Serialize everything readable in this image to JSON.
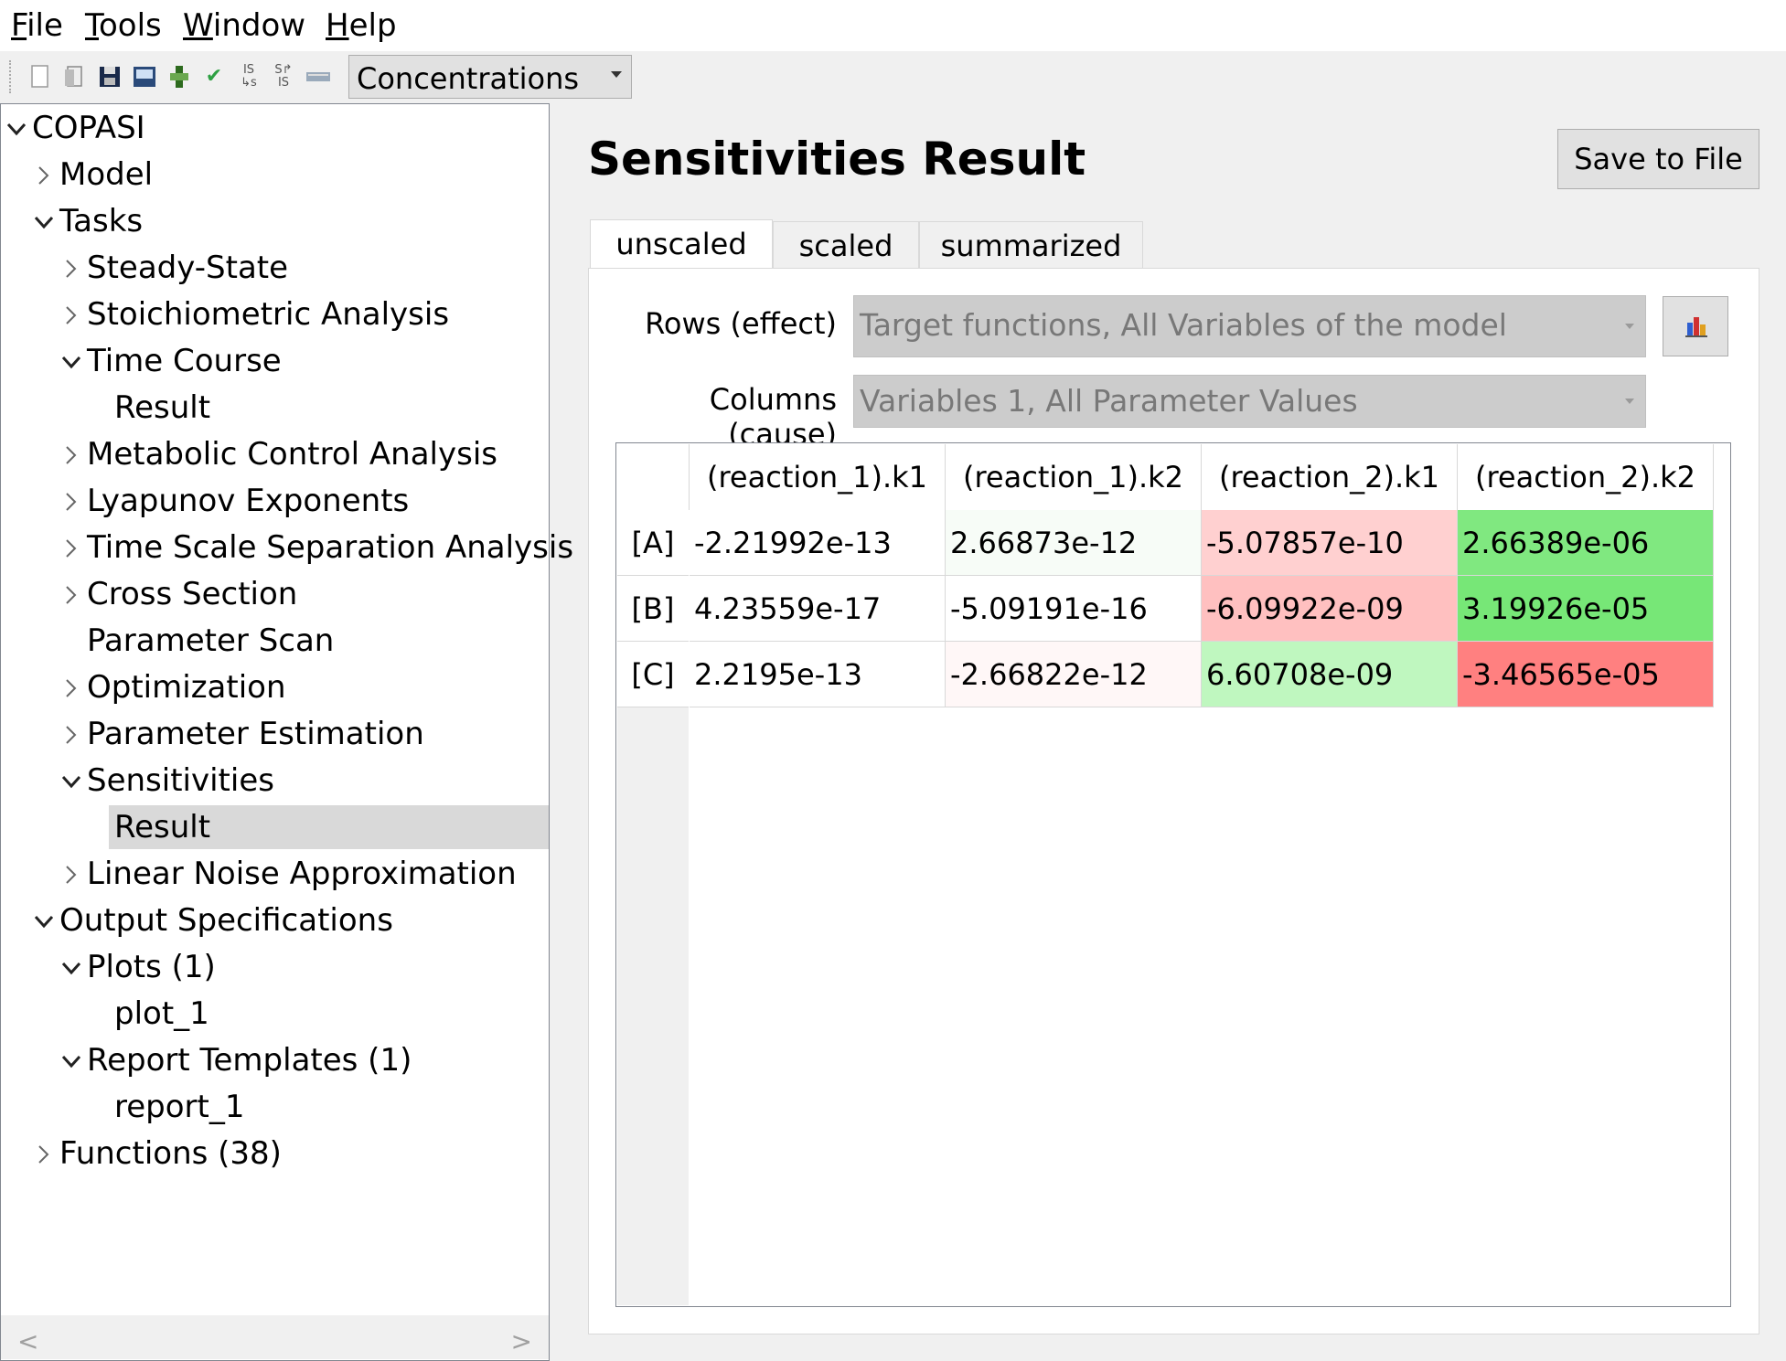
{
  "menubar": {
    "items": [
      {
        "label": "File",
        "mnemonic": "F",
        "rest": "ile"
      },
      {
        "label": "Tools",
        "mnemonic": "T",
        "rest": "ools"
      },
      {
        "label": "Window",
        "mnemonic": "W",
        "rest": "indow"
      },
      {
        "label": "Help",
        "mnemonic": "H",
        "rest": "elp"
      }
    ]
  },
  "toolbar": {
    "icons": [
      "new-icon",
      "open-icon",
      "save-icon",
      "save-as-icon",
      "cell-icon",
      "check-icon",
      "import-sbml-icon",
      "export-sbml-icon",
      "slider-icon"
    ],
    "unit_combo": "Concentrations"
  },
  "tree": {
    "items": [
      {
        "label": "COPASI",
        "chevron": "down"
      },
      {
        "label": "Model",
        "chevron": "right"
      },
      {
        "label": "Tasks",
        "chevron": "down"
      },
      {
        "label": "Steady-State",
        "chevron": "right"
      },
      {
        "label": "Stoichiometric Analysis",
        "chevron": "right"
      },
      {
        "label": "Time Course",
        "chevron": "down"
      },
      {
        "label": "Result",
        "chevron": ""
      },
      {
        "label": "Metabolic Control Analysis",
        "chevron": "right"
      },
      {
        "label": "Lyapunov Exponents",
        "chevron": "right"
      },
      {
        "label": "Time Scale Separation Analysis",
        "chevron": "right"
      },
      {
        "label": "Cross Section",
        "chevron": "right"
      },
      {
        "label": "Parameter Scan",
        "chevron": ""
      },
      {
        "label": "Optimization",
        "chevron": "right"
      },
      {
        "label": "Parameter Estimation",
        "chevron": "right"
      },
      {
        "label": "Sensitivities",
        "chevron": "down"
      },
      {
        "label": "Result",
        "chevron": "",
        "selected": true
      },
      {
        "label": "Linear Noise Approximation",
        "chevron": "right"
      },
      {
        "label": "Output Specifications",
        "chevron": "down"
      },
      {
        "label": "Plots (1)",
        "chevron": "down"
      },
      {
        "label": "plot_1",
        "chevron": ""
      },
      {
        "label": "Report Templates (1)",
        "chevron": "down"
      },
      {
        "label": "report_1",
        "chevron": ""
      },
      {
        "label": "Functions (38)",
        "chevron": "right"
      }
    ],
    "scroll_left": "<",
    "scroll_right": ">"
  },
  "main": {
    "title": "Sensitivities Result",
    "save_button": "Save to File",
    "tabs": [
      {
        "label": "unscaled",
        "active": true
      },
      {
        "label": "scaled",
        "active": false
      },
      {
        "label": "summarized",
        "active": false
      }
    ],
    "rows_label": "Rows (effect)",
    "rows_value": "Target functions, All Variables of the model",
    "columns_label": "Columns (cause)",
    "columns_value": "Variables 1, All Parameter Values",
    "table": {
      "columns": [
        "(reaction_1).k1",
        "(reaction_1).k2",
        "(reaction_2).k1",
        "(reaction_2).k2"
      ],
      "rows": [
        {
          "label": "[A]",
          "cells": [
            {
              "value": "-2.21992e-13",
              "color": "#ffffff"
            },
            {
              "value": "2.66873e-12",
              "color": "#f7fcf7"
            },
            {
              "value": "-5.07857e-10",
              "color": "#ffd0d0"
            },
            {
              "value": "2.66389e-06",
              "color": "#80e880"
            }
          ]
        },
        {
          "label": "[B]",
          "cells": [
            {
              "value": "4.23559e-17",
              "color": "#ffffff"
            },
            {
              "value": "-5.09191e-16",
              "color": "#ffffff"
            },
            {
              "value": "-6.09922e-09",
              "color": "#ffc0c0"
            },
            {
              "value": "3.19926e-05",
              "color": "#77e777"
            }
          ]
        },
        {
          "label": "[C]",
          "cells": [
            {
              "value": "2.2195e-13",
              "color": "#ffffff"
            },
            {
              "value": "-2.66822e-12",
              "color": "#fff7f7"
            },
            {
              "value": "6.60708e-09",
              "color": "#bff7bf"
            },
            {
              "value": "-3.46565e-05",
              "color": "#ff8080"
            }
          ]
        }
      ]
    }
  }
}
